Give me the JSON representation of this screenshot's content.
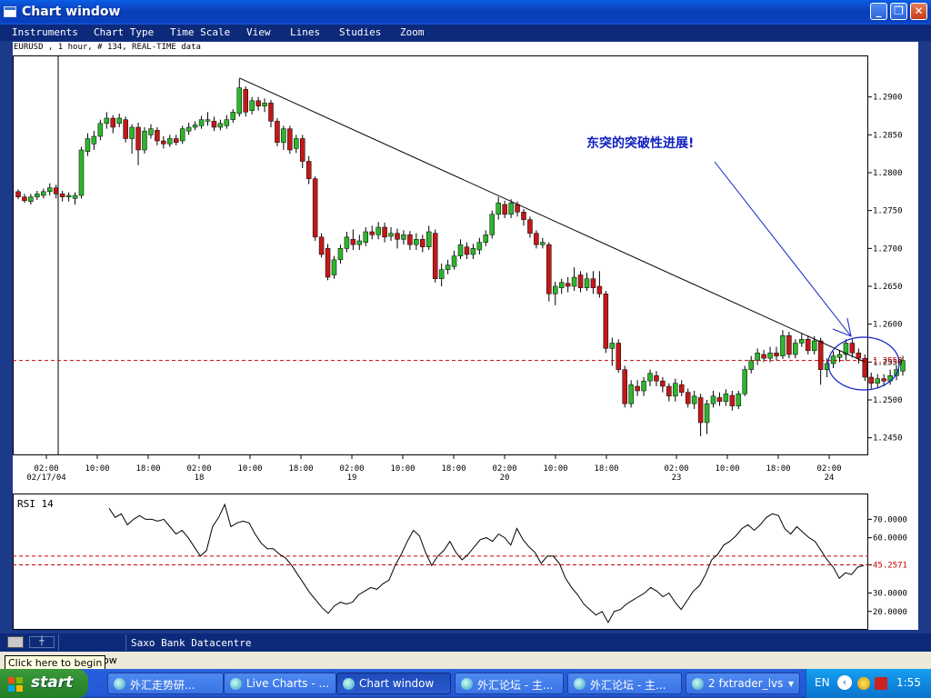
{
  "window": {
    "title": "Chart window",
    "buttons": {
      "minimize": "_",
      "maximize": "❐",
      "close": "✕"
    }
  },
  "menu": [
    "Instruments",
    "Chart Type",
    "Time Scale",
    "View",
    "Lines",
    "Studies",
    "Zoom"
  ],
  "info_line": "EURUSD , 1 hour, # 134, REAL-TIME data",
  "status_bar": {
    "datacentre": "Saxo Bank Datacentre",
    "hint_partial": "dow",
    "tooltip": "Click here to begin"
  },
  "taskbar": {
    "start_label": "start",
    "tasks": [
      {
        "label": "外汇走势研...",
        "active": false
      },
      {
        "label": "Live Charts - ...",
        "active": false
      },
      {
        "label": "Chart window",
        "active": true
      },
      {
        "label": "外汇论坛 - 主...",
        "active": false
      },
      {
        "label": "外汇论坛 - 主...",
        "active": false
      },
      {
        "label": "2 fxtrader_lvs",
        "active": false
      }
    ],
    "language": "EN",
    "clock": "1:55"
  },
  "colors": {
    "bull": "#2db52d",
    "bear": "#c41818",
    "dashed": "#cc0000",
    "annotation": "#1020c0"
  },
  "chart_data": [
    {
      "type": "candlestick",
      "title": "EURUSD , 1 hour, # 134, REAL-TIME data",
      "y_ticks": [
        1.29,
        1.285,
        1.28,
        1.275,
        1.27,
        1.265,
        1.26,
        1.255,
        1.25,
        1.245
      ],
      "y_tick_labels": [
        "1.2900",
        "1.2850",
        "1.2800",
        "1.2750",
        "1.2700",
        "1.2650",
        "1.2600",
        "1.2550",
        "1.2500",
        "1.2450"
      ],
      "ylim": [
        1.2434,
        1.295
      ],
      "current_price": 1.2552,
      "current_price_label": "1.2552",
      "x_ticks": [
        {
          "label": "02:00",
          "sub": "02/17/04",
          "hour": 2
        },
        {
          "label": "10:00",
          "sub": "",
          "hour": 10
        },
        {
          "label": "18:00",
          "sub": "",
          "hour": 18
        },
        {
          "label": "02:00",
          "sub": "18",
          "hour": 26
        },
        {
          "label": "10:00",
          "sub": "",
          "hour": 34
        },
        {
          "label": "18:00",
          "sub": "",
          "hour": 42
        },
        {
          "label": "02:00",
          "sub": "19",
          "hour": 50
        },
        {
          "label": "10:00",
          "sub": "",
          "hour": 58
        },
        {
          "label": "18:00",
          "sub": "",
          "hour": 66
        },
        {
          "label": "02:00",
          "sub": "20",
          "hour": 74
        },
        {
          "label": "10:00",
          "sub": "",
          "hour": 82
        },
        {
          "label": "18:00",
          "sub": "",
          "hour": 90
        },
        {
          "label": "02:00",
          "sub": "23",
          "hour": 101
        },
        {
          "label": "10:00",
          "sub": "",
          "hour": 109
        },
        {
          "label": "18:00",
          "sub": "",
          "hour": 117
        },
        {
          "label": "02:00",
          "sub": "24",
          "hour": 125
        }
      ],
      "candles": [
        [
          1.2775,
          1.2768,
          1.2778,
          1.2765
        ],
        [
          1.2768,
          1.2763,
          1.2772,
          1.276
        ],
        [
          1.2762,
          1.2768,
          1.2772,
          1.2758
        ],
        [
          1.2768,
          1.2772,
          1.2776,
          1.2764
        ],
        [
          1.277,
          1.2775,
          1.2779,
          1.2766
        ],
        [
          1.2775,
          1.278,
          1.2786,
          1.277
        ],
        [
          1.278,
          1.2772,
          1.2784,
          1.2766
        ],
        [
          1.2772,
          1.2768,
          1.2776,
          1.2762
        ],
        [
          1.2768,
          1.277,
          1.2774,
          1.2762
        ],
        [
          1.2766,
          1.277,
          1.2774,
          1.2758
        ],
        [
          1.277,
          1.283,
          1.2834,
          1.2766
        ],
        [
          1.2828,
          1.2845,
          1.2852,
          1.2822
        ],
        [
          1.2838,
          1.2848,
          1.2855,
          1.283
        ],
        [
          1.2848,
          1.2865,
          1.287,
          1.2843
        ],
        [
          1.2865,
          1.2872,
          1.288,
          1.2858
        ],
        [
          1.2872,
          1.286,
          1.2876,
          1.2852
        ],
        [
          1.2865,
          1.2872,
          1.2878,
          1.286
        ],
        [
          1.287,
          1.2845,
          1.2874,
          1.284
        ],
        [
          1.2845,
          1.286,
          1.2864,
          1.2825
        ],
        [
          1.286,
          1.283,
          1.2866,
          1.281
        ],
        [
          1.283,
          1.2855,
          1.286,
          1.2825
        ],
        [
          1.285,
          1.2858,
          1.2864,
          1.2845
        ],
        [
          1.2856,
          1.2842,
          1.286,
          1.2836
        ],
        [
          1.2842,
          1.2838,
          1.2848,
          1.2832
        ],
        [
          1.2838,
          1.2845,
          1.285,
          1.2834
        ],
        [
          1.2845,
          1.284,
          1.285,
          1.2836
        ],
        [
          1.2842,
          1.2858,
          1.2862,
          1.2838
        ],
        [
          1.2855,
          1.286,
          1.2866,
          1.285
        ],
        [
          1.286,
          1.2863,
          1.2868,
          1.2856
        ],
        [
          1.2862,
          1.287,
          1.2875,
          1.2858
        ],
        [
          1.2868,
          1.287,
          1.288,
          1.2862
        ],
        [
          1.2868,
          1.286,
          1.2874,
          1.2855
        ],
        [
          1.286,
          1.2865,
          1.287,
          1.2856
        ],
        [
          1.2862,
          1.287,
          1.2876,
          1.2858
        ],
        [
          1.287,
          1.288,
          1.2884,
          1.2866
        ],
        [
          1.2878,
          1.2912,
          1.2924,
          1.2874
        ],
        [
          1.291,
          1.288,
          1.2914,
          1.2874
        ],
        [
          1.2882,
          1.2895,
          1.29,
          1.2877
        ],
        [
          1.2895,
          1.2888,
          1.29,
          1.2882
        ],
        [
          1.2888,
          1.2892,
          1.2898,
          1.288
        ],
        [
          1.2892,
          1.2868,
          1.2896,
          1.286
        ],
        [
          1.2868,
          1.284,
          1.2872,
          1.2835
        ],
        [
          1.284,
          1.2858,
          1.2862,
          1.283
        ],
        [
          1.2858,
          1.283,
          1.2862,
          1.2825
        ],
        [
          1.2832,
          1.2845,
          1.285,
          1.2826
        ],
        [
          1.2845,
          1.2815,
          1.285,
          1.2806
        ],
        [
          1.2815,
          1.2792,
          1.2822,
          1.2785
        ],
        [
          1.2792,
          1.2715,
          1.2795,
          1.271
        ],
        [
          1.2715,
          1.2692,
          1.272,
          1.2688
        ],
        [
          1.27,
          1.2662,
          1.2706,
          1.2658
        ],
        [
          1.2665,
          1.2685,
          1.269,
          1.266
        ],
        [
          1.2685,
          1.27,
          1.2705,
          1.268
        ],
        [
          1.27,
          1.2715,
          1.2722,
          1.2695
        ],
        [
          1.2712,
          1.2705,
          1.2725,
          1.2698
        ],
        [
          1.2705,
          1.271,
          1.2718,
          1.2698
        ],
        [
          1.2708,
          1.2722,
          1.2728,
          1.2703
        ],
        [
          1.2722,
          1.2718,
          1.273,
          1.2712
        ],
        [
          1.2718,
          1.2728,
          1.2735,
          1.2712
        ],
        [
          1.2728,
          1.2715,
          1.2734,
          1.2708
        ],
        [
          1.2716,
          1.272,
          1.2728,
          1.271
        ],
        [
          1.272,
          1.2712,
          1.2726,
          1.27
        ],
        [
          1.2712,
          1.2718,
          1.2724,
          1.2705
        ],
        [
          1.2718,
          1.2705,
          1.2723,
          1.2698
        ],
        [
          1.2705,
          1.2712,
          1.272,
          1.2698
        ],
        [
          1.2712,
          1.2702,
          1.2718,
          1.2695
        ],
        [
          1.2702,
          1.2722,
          1.273,
          1.2698
        ],
        [
          1.272,
          1.266,
          1.2725,
          1.2655
        ],
        [
          1.266,
          1.2672,
          1.268,
          1.265
        ],
        [
          1.2672,
          1.2678,
          1.2685,
          1.2666
        ],
        [
          1.2676,
          1.269,
          1.2697,
          1.2672
        ],
        [
          1.269,
          1.2705,
          1.2712,
          1.2686
        ],
        [
          1.2702,
          1.2692,
          1.2708,
          1.2686
        ],
        [
          1.2692,
          1.27,
          1.2706,
          1.2686
        ],
        [
          1.2698,
          1.2708,
          1.2714,
          1.2692
        ],
        [
          1.2708,
          1.2718,
          1.2724,
          1.2703
        ],
        [
          1.2718,
          1.2745,
          1.275,
          1.2713
        ],
        [
          1.2745,
          1.276,
          1.2768,
          1.2738
        ],
        [
          1.2758,
          1.2745,
          1.2763,
          1.274
        ],
        [
          1.2745,
          1.276,
          1.2765,
          1.274
        ],
        [
          1.2758,
          1.2748,
          1.2762,
          1.2742
        ],
        [
          1.2748,
          1.2738,
          1.2752,
          1.273
        ],
        [
          1.2738,
          1.272,
          1.2742,
          1.2714
        ],
        [
          1.272,
          1.2705,
          1.2724,
          1.27
        ],
        [
          1.2705,
          1.2708,
          1.2714,
          1.27
        ],
        [
          1.2705,
          1.264,
          1.2708,
          1.263
        ],
        [
          1.264,
          1.265,
          1.2656,
          1.2625
        ],
        [
          1.2648,
          1.2655,
          1.266,
          1.264
        ],
        [
          1.2654,
          1.265,
          1.2662,
          1.2642
        ],
        [
          1.265,
          1.2662,
          1.2675,
          1.2644
        ],
        [
          1.2665,
          1.2648,
          1.267,
          1.2642
        ],
        [
          1.2648,
          1.266,
          1.2668,
          1.2644
        ],
        [
          1.266,
          1.2648,
          1.267,
          1.264
        ],
        [
          1.265,
          1.264,
          1.267,
          1.2635
        ],
        [
          1.264,
          1.2568,
          1.2644,
          1.2562
        ],
        [
          1.2568,
          1.2575,
          1.2582,
          1.2545
        ],
        [
          1.2575,
          1.254,
          1.258,
          1.2536
        ],
        [
          1.254,
          1.2495,
          1.2545,
          1.249
        ],
        [
          1.2495,
          1.252,
          1.2526,
          1.249
        ],
        [
          1.2518,
          1.2512,
          1.2526,
          1.2505
        ],
        [
          1.2512,
          1.2525,
          1.253,
          1.2505
        ],
        [
          1.2525,
          1.2535,
          1.254,
          1.2518
        ],
        [
          1.2532,
          1.2525,
          1.2538,
          1.2518
        ],
        [
          1.2525,
          1.2518,
          1.253,
          1.251
        ],
        [
          1.2518,
          1.2505,
          1.2522,
          1.2498
        ],
        [
          1.2505,
          1.2522,
          1.2528,
          1.2498
        ],
        [
          1.252,
          1.251,
          1.2526,
          1.2505
        ],
        [
          1.251,
          1.2495,
          1.2515,
          1.249
        ],
        [
          1.2495,
          1.2505,
          1.2512,
          1.2488
        ],
        [
          1.2503,
          1.247,
          1.2508,
          1.2452
        ],
        [
          1.247,
          1.2495,
          1.25,
          1.2455
        ],
        [
          1.2495,
          1.2505,
          1.2512,
          1.249
        ],
        [
          1.2503,
          1.2498,
          1.251,
          1.2492
        ],
        [
          1.2498,
          1.2508,
          1.2514,
          1.2492
        ],
        [
          1.2506,
          1.2492,
          1.2512,
          1.2486
        ],
        [
          1.2492,
          1.2508,
          1.2512,
          1.2488
        ],
        [
          1.2508,
          1.254,
          1.2545,
          1.2505
        ],
        [
          1.254,
          1.2552,
          1.2558,
          1.2535
        ],
        [
          1.2552,
          1.2562,
          1.2568,
          1.2546
        ],
        [
          1.256,
          1.2555,
          1.2566,
          1.255
        ],
        [
          1.2555,
          1.2562,
          1.257,
          1.255
        ],
        [
          1.2562,
          1.2558,
          1.257,
          1.2552
        ],
        [
          1.2558,
          1.2585,
          1.2592,
          1.2554
        ],
        [
          1.2585,
          1.256,
          1.259,
          1.2555
        ],
        [
          1.256,
          1.2575,
          1.258,
          1.2555
        ],
        [
          1.2575,
          1.258,
          1.2588,
          1.257
        ],
        [
          1.258,
          1.2565,
          1.2585,
          1.256
        ],
        [
          1.2565,
          1.2578,
          1.2584,
          1.256
        ],
        [
          1.2578,
          1.254,
          1.2582,
          1.252
        ],
        [
          1.254,
          1.2548,
          1.2555,
          1.253
        ],
        [
          1.2548,
          1.2558,
          1.2564,
          1.2542
        ],
        [
          1.2556,
          1.256,
          1.2566,
          1.255
        ],
        [
          1.256,
          1.2575,
          1.258,
          1.2552
        ],
        [
          1.2575,
          1.2562,
          1.258,
          1.2556
        ],
        [
          1.2562,
          1.2555,
          1.2568,
          1.2548
        ],
        [
          1.2555,
          1.253,
          1.256,
          1.2525
        ],
        [
          1.253,
          1.2522,
          1.2536,
          1.2515
        ],
        [
          1.2522,
          1.2528,
          1.2534,
          1.2515
        ],
        [
          1.2528,
          1.2525,
          1.2534,
          1.2518
        ],
        [
          1.2525,
          1.2532,
          1.254,
          1.252
        ],
        [
          1.2532,
          1.254,
          1.2546,
          1.2526
        ],
        [
          1.2538,
          1.2552,
          1.2558,
          1.2532
        ]
      ],
      "trendline": [
        [
          35,
          1.2925
        ],
        [
          134,
          1.255
        ]
      ],
      "annotation": "东突的突破性进展!"
    },
    {
      "type": "line",
      "title": "RSI 14",
      "y_ticks": [
        70,
        60,
        45.2571,
        30,
        20
      ],
      "y_tick_labels": [
        "70.0000",
        "60.0000",
        "45.2571",
        "30.0000",
        "20.0000"
      ],
      "ylim": [
        11,
        83
      ],
      "reference_lines": [
        50,
        45.2571
      ],
      "values": [
        76,
        71,
        73,
        67,
        70,
        72,
        70,
        70,
        69,
        70,
        66,
        62,
        64,
        60,
        55,
        50,
        53,
        66,
        71,
        78,
        66,
        68,
        69,
        68,
        62,
        57,
        54,
        54,
        51,
        49,
        45,
        40,
        35,
        30,
        26,
        22,
        19,
        23,
        25,
        24,
        25,
        29,
        31,
        33,
        32,
        35,
        37,
        45,
        51,
        58,
        64,
        61,
        52,
        45,
        50,
        53,
        58,
        52,
        48,
        51,
        55,
        59,
        60,
        58,
        62,
        60,
        56,
        65,
        59,
        55,
        52,
        46,
        50,
        50,
        46,
        38,
        33,
        29,
        24,
        21,
        18,
        20,
        14,
        20,
        21,
        24,
        26,
        28,
        30,
        33,
        31,
        28,
        30,
        25,
        21,
        26,
        31,
        34,
        40,
        48,
        51,
        56,
        58,
        61,
        65,
        67,
        64,
        67,
        71,
        73,
        72,
        65,
        62,
        66,
        63,
        60,
        58,
        53,
        48,
        44,
        38,
        41,
        40,
        44,
        45
      ]
    }
  ]
}
